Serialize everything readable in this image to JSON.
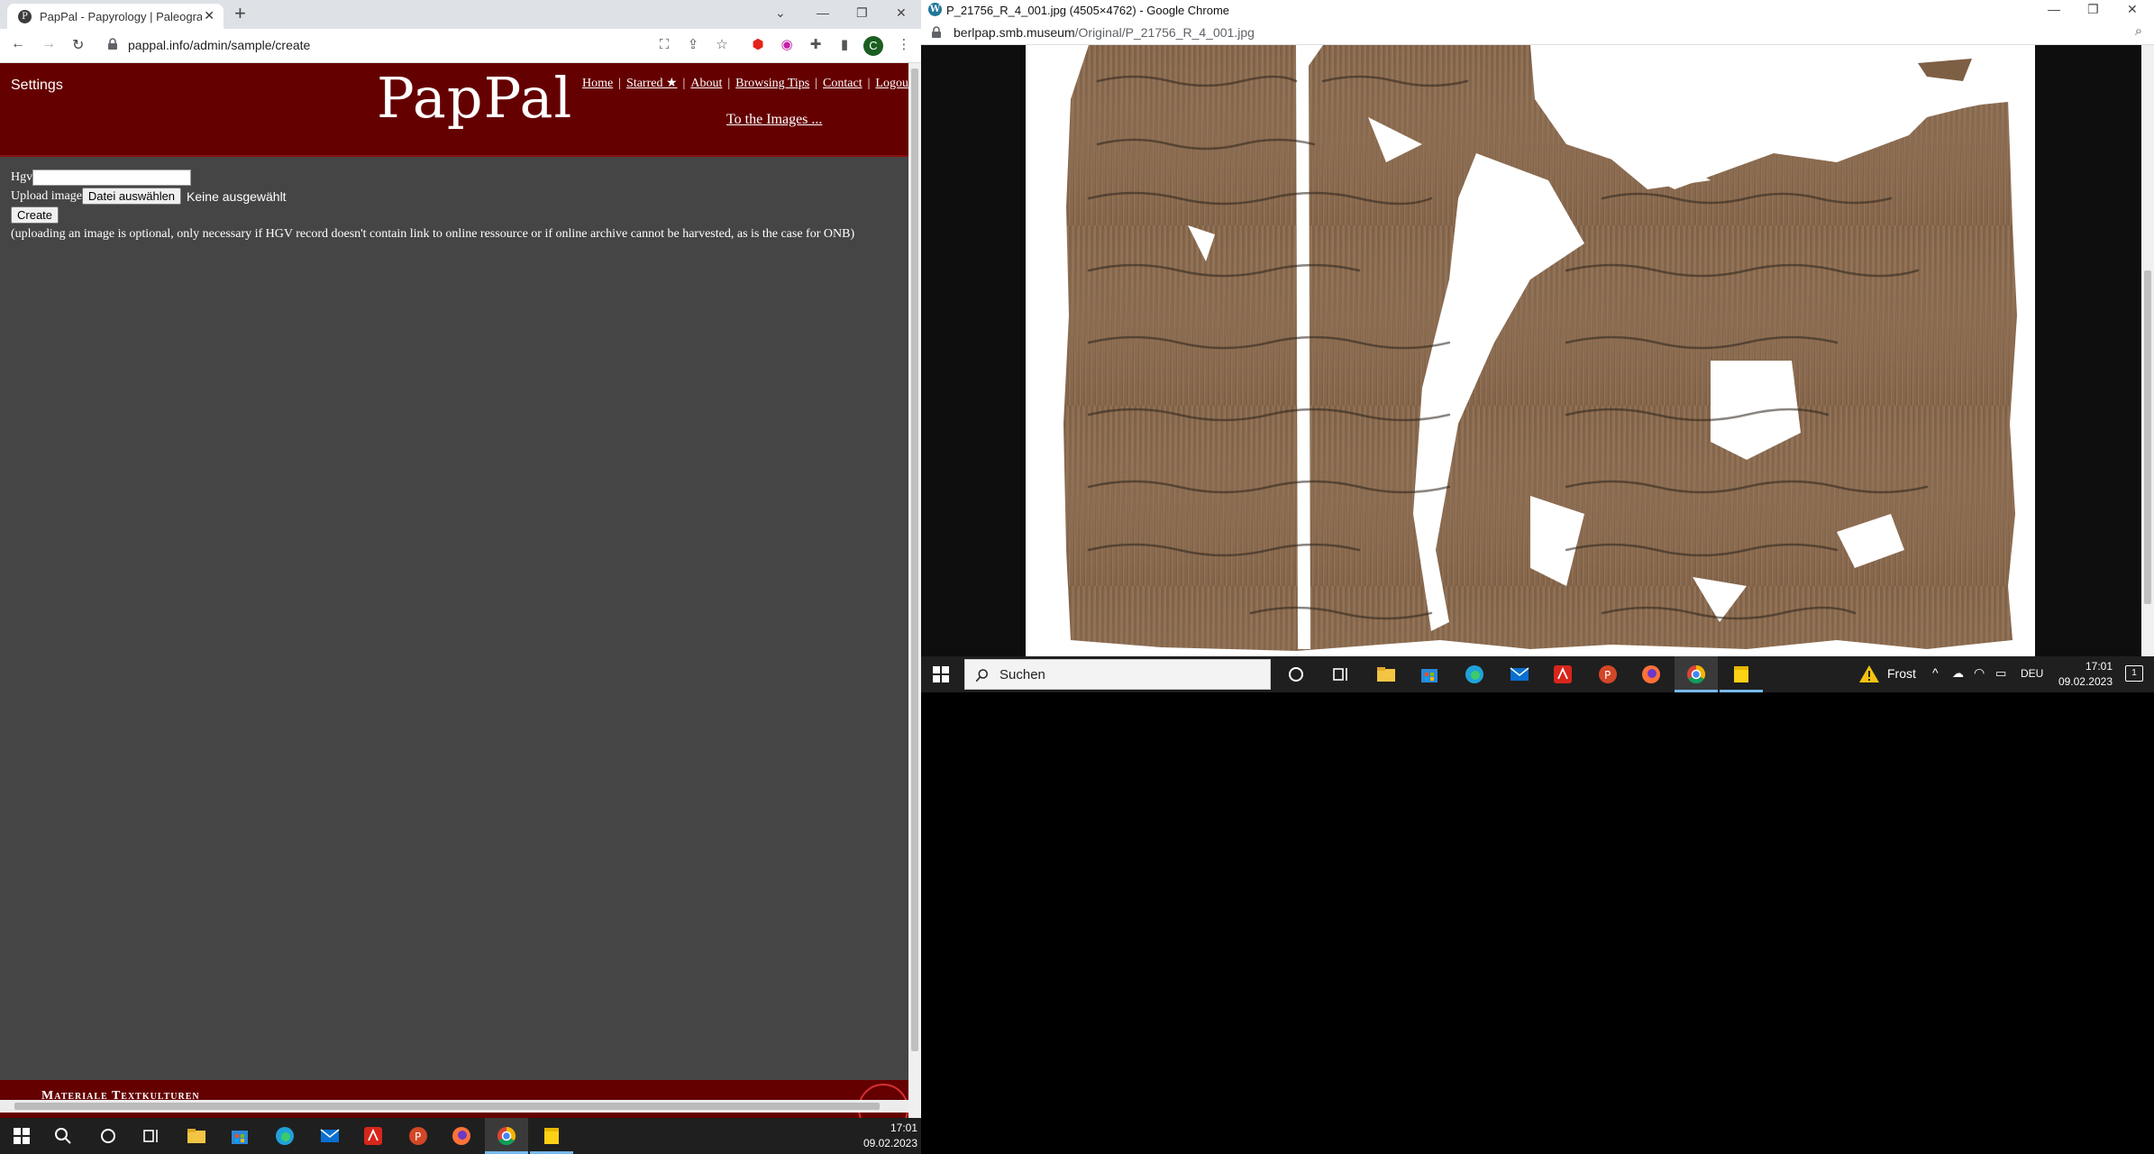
{
  "left_window": {
    "tab_title": "PapPal - Papyrology | Paleograph",
    "url": "pappal.info/admin/sample/create",
    "profile_initial": "C"
  },
  "pappal": {
    "settings": "Settings",
    "logo": "PapPal",
    "nav": {
      "home": "Home",
      "starred": "Starred ★",
      "about": "About",
      "browsing_tips": "Browsing Tips",
      "contact": "Contact",
      "logout": "Logou"
    },
    "to_images": "To the Images ...",
    "form": {
      "hgv_label": "Hgv",
      "hgv_value": "",
      "upload_label": "Upload image",
      "file_button": "Datei auswählen",
      "no_file": "Keine ausgewählt",
      "create_button": "Create",
      "hint": "(uploading an image is optional, only necessary if HGV record doesn't contain link to online ressource or if online archive cannot be harvested, as is the case for ONB)"
    },
    "footer": "Materiale Textkulturen"
  },
  "left_taskbar": {
    "time": "17:01",
    "date": "09.02.2023"
  },
  "right_window": {
    "title": "P_21756_R_4_001.jpg (4505×4762) - Google Chrome",
    "url_host": "berlpap.smb.museum",
    "url_path": "/Original/P_21756_R_4_001.jpg"
  },
  "right_taskbar": {
    "search_placeholder": "Suchen",
    "weather": "Frost",
    "language": "DEU",
    "time": "17:01",
    "date": "09.02.2023",
    "notification_count": "1"
  },
  "colors": {
    "header_red": "#650000",
    "page_gray": "#454545",
    "papyrus": "#8a6a4c"
  }
}
